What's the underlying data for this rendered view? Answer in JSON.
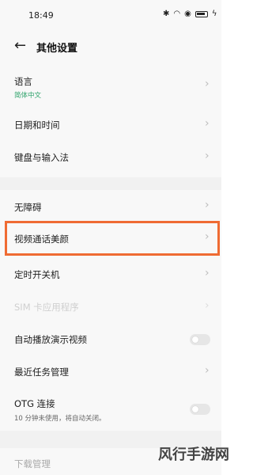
{
  "status": {
    "time": "18:49",
    "icons": [
      "bluetooth-icon",
      "wifi-icon",
      "location-icon",
      "battery-icon",
      "charging-icon"
    ]
  },
  "header": {
    "title": "其他设置",
    "back_icon": "back-arrow-icon"
  },
  "rows": {
    "language": {
      "label": "语言",
      "sub": "简体中文"
    },
    "datetime": {
      "label": "日期和时间"
    },
    "keyboard": {
      "label": "键盘与输入法"
    },
    "accessibility": {
      "label": "无障碍"
    },
    "video_beauty": {
      "label": "视频通话美颜"
    },
    "schedule_power": {
      "label": "定时开关机"
    },
    "sim_apps": {
      "label": "SIM 卡应用程序"
    },
    "auto_demo_video": {
      "label": "自动播放演示视频",
      "toggle_on": false
    },
    "recent_tasks": {
      "label": "最近任务管理"
    },
    "otg": {
      "label": "OTG 连接",
      "sub": "10 分钟未使用，将自动关闭。",
      "toggle_on": false
    },
    "downloads": {
      "label": "下载管理"
    }
  },
  "watermark": "风行手游网",
  "colors": {
    "highlight": "#ef6b33",
    "accent_green": "#2fa36b"
  }
}
